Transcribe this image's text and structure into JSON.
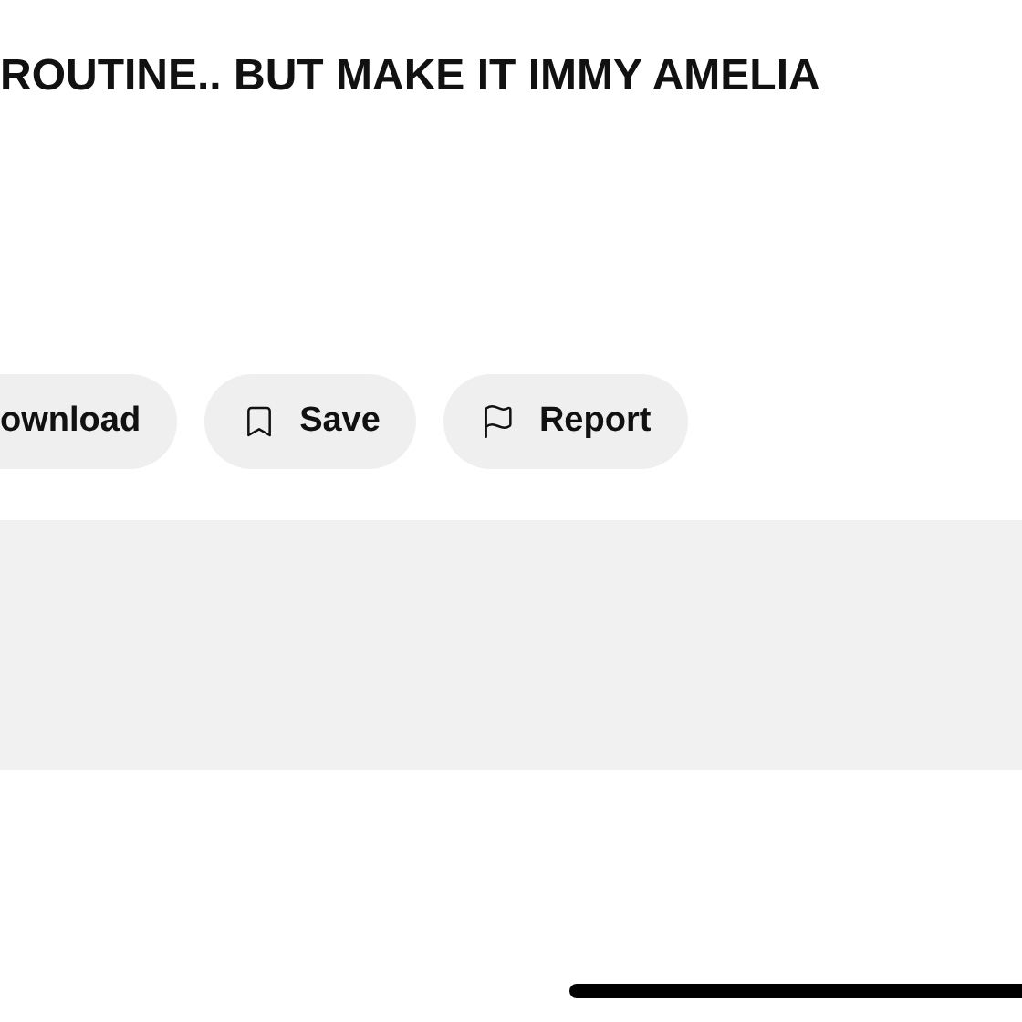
{
  "title": "ROUTINE.. BUT MAKE IT IMMY AMELIA",
  "actions": [
    {
      "kind": "download",
      "label": "ownload"
    },
    {
      "kind": "save",
      "label": "Save"
    },
    {
      "kind": "report",
      "label": "Report"
    }
  ]
}
